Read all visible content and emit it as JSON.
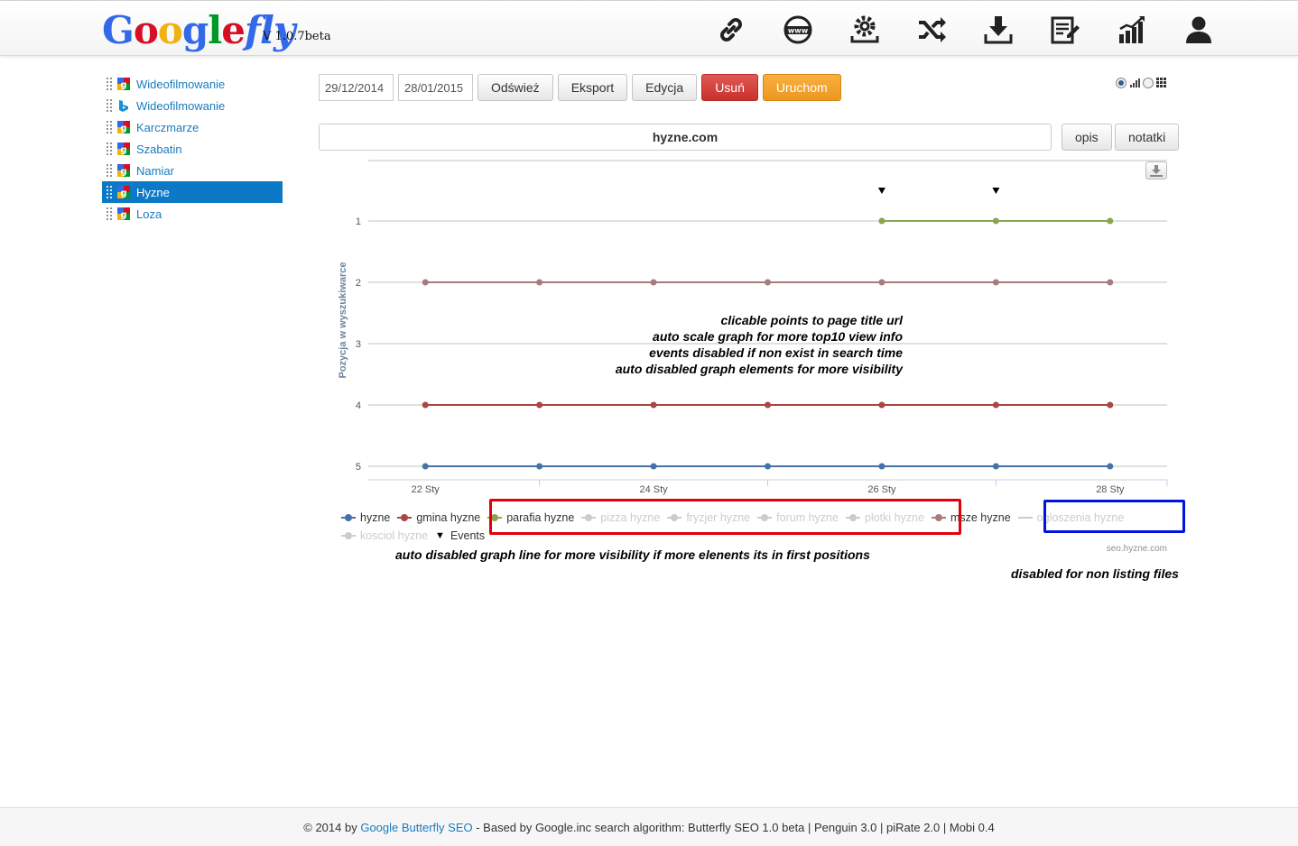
{
  "header": {
    "logo": {
      "text": "Googlefly",
      "version": "V 1.0.7beta"
    },
    "nav": [
      {
        "icon": "link-icon"
      },
      {
        "icon": "www-icon"
      },
      {
        "icon": "settings-icon"
      },
      {
        "icon": "shuffle-icon"
      },
      {
        "icon": "download-icon"
      },
      {
        "icon": "notes-icon"
      },
      {
        "icon": "stats-icon"
      },
      {
        "icon": "user-icon"
      }
    ]
  },
  "sidebar": {
    "items": [
      {
        "label": "Wideofilmowanie",
        "icon": "google-icon",
        "active": false
      },
      {
        "label": "Wideofilmowanie",
        "icon": "bing-icon",
        "active": false
      },
      {
        "label": "Karczmarze",
        "icon": "google-icon",
        "active": false
      },
      {
        "label": "Szabatin",
        "icon": "google-icon",
        "active": false
      },
      {
        "label": "Namiar",
        "icon": "google-icon",
        "active": false
      },
      {
        "label": "Hyzne",
        "icon": "google-icon",
        "active": true
      },
      {
        "label": "Loza",
        "icon": "google-icon",
        "active": false
      }
    ]
  },
  "toolbar": {
    "date_from": "29/12/2014",
    "date_to": "28/01/2015",
    "refresh": "Odśwież",
    "export": "Eksport",
    "edit": "Edycja",
    "delete": "Usuń",
    "run": "Uruchom"
  },
  "title_bar": {
    "value": "hyzne.com",
    "opis": "opis",
    "notatki": "notatki"
  },
  "notes": [
    "clicable points to page title url",
    "auto scale graph for more top10 view info",
    "events disabled if non exist in search time",
    "auto disabled graph elements for more visibility"
  ],
  "note_legend": "auto disabled graph line for more visibility if more elenents its in first positions",
  "note_disabled": "disabled for non listing files",
  "chart_data": {
    "type": "line",
    "ylabel": "Pozycja w wyszukiwarce",
    "y_reversed": true,
    "ylim": [
      1,
      5
    ],
    "y_ticks": [
      "1",
      "2",
      "3",
      "4",
      "5"
    ],
    "x_ticks": [
      "22 Sty",
      "24 Sty",
      "26 Sty",
      "28 Sty"
    ],
    "x_range": [
      21.5,
      28.5
    ],
    "x": [
      22,
      23,
      24,
      25,
      26,
      27,
      28
    ],
    "series": [
      {
        "name": "hyzne",
        "color": "#4572a7",
        "values": [
          5,
          5,
          5,
          5,
          5,
          5,
          5
        ],
        "enabled": true
      },
      {
        "name": "gmina hyzne",
        "color": "#aa4643",
        "values": [
          4,
          4,
          4,
          4,
          4,
          4,
          4
        ],
        "enabled": true
      },
      {
        "name": "parafia hyzne",
        "color": "#89a54e",
        "values": [
          null,
          null,
          null,
          null,
          1,
          1,
          1
        ],
        "enabled": true
      },
      {
        "name": "pizza hyzne",
        "color": "#cccccc",
        "values": [],
        "enabled": false
      },
      {
        "name": "fryzjer hyzne",
        "color": "#cccccc",
        "values": [],
        "enabled": false
      },
      {
        "name": "forum hyzne",
        "color": "#cccccc",
        "values": [],
        "enabled": false
      },
      {
        "name": "plotki hyzne",
        "color": "#cccccc",
        "values": [],
        "enabled": false
      },
      {
        "name": "msze hyzne",
        "color": "#a47d7c",
        "values": [
          2,
          2,
          2,
          2,
          2,
          2,
          2
        ],
        "enabled": true
      },
      {
        "name": "ogloszenia hyzne",
        "color": "#cccccc",
        "values": [],
        "enabled": false,
        "plain": true
      },
      {
        "name": "kosciol hyzne",
        "color": "#cccccc",
        "values": [],
        "enabled": false
      }
    ],
    "events": {
      "name": "Events",
      "x": [
        26,
        27
      ]
    },
    "credit": "seo.hyzne.com"
  },
  "footer": {
    "prefix": "© 2014 by ",
    "link": "Google Butterfly SEO",
    "suffix": " - Based by Google.inc search algorithm: Butterfly SEO 1.0 beta | Penguin 3.0 | piRate 2.0 | Mobi 0.4"
  }
}
